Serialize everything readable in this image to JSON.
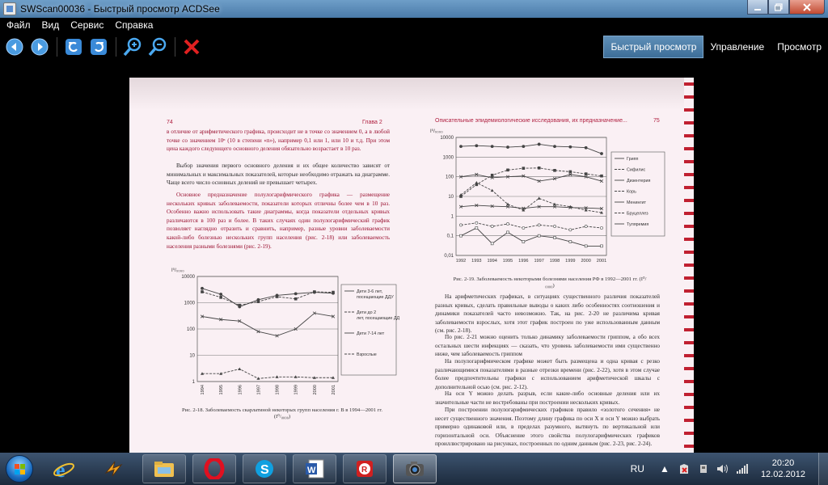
{
  "window": {
    "title": "SWScan00036 - Быстрый просмотр ACDSee"
  },
  "menu": [
    "Файл",
    "Вид",
    "Сервис",
    "Справка"
  ],
  "toolbar": {
    "buttons": [
      "back-icon",
      "forward-icon",
      "rotate-left-icon",
      "rotate-right-icon",
      "zoom-in-icon",
      "zoom-out-icon",
      "delete-icon"
    ]
  },
  "tabs": [
    {
      "label": "Быстрый просмотр",
      "active": true
    },
    {
      "label": "Управление",
      "active": false
    },
    {
      "label": "Просмотр",
      "active": false
    }
  ],
  "document": {
    "left_page_number": "74",
    "left_chapter": "Глава 2",
    "right_header": "Описательные эпидемиологические исследования, их предназначение...",
    "right_page_number": "75",
    "left_text_top_red": "в отличие от арифметического графика, происходит не в точке со значением 0, а в любой точке со значением 10ⁿ (10 в степени «n»), например 0,1 или 1, или 10 и т.д. При этом цена каждого следующего основного деления обязательно возрастает в 10 раз.",
    "left_text_p2": "Выбор значения первого основного деления и их общее количество зависят от минимальных и максимальных показателей, которые необходимо отражать на диаграмме. Чаще всего число основных делений не превышает четырех.",
    "left_text_p3": "Основное предназначение полулогарифмического графика — размещение нескольких кривых заболеваемости, показатели которых отличны более чем в 10 раз. Особенно важно использовать такие диаграммы, когда показатели отдельных кривых различаются в 100 раз и более. В таких случаях один полулогарифмический график позволяет наглядно отразить и сравнить, например, разные уровни заболеваемости какой-либо болезнью нескольких групп населения (рис. 2-18) или заболеваемость населения разными болезнями (рис. 2-19).",
    "fig18_caption": "Рис. 2-18. Заболеваемость скарлатиной некоторых групп населения г. В в 1994—2001 гг. (I⁰/₀₀₀₀)",
    "fig19_caption": "Рис. 2-19. Заболеваемость некоторыми болезнями населения РФ в 1992—2001 гг. (I⁰/₀₀₀₀)",
    "right_text_p1": "На арифметических графиках, в ситуациях существенного различия показателей разных кривых, сделать правильные выводы о каких либо особенностях соотношения и динамики показателей часто невозможно. Так, на рис. 2-20 не различима кривая заболеваемости взрослых, хотя этот график построен по уже использованным данным (см. рис. 2-18).",
    "right_text_p2": "По рис. 2-21 можно оценить только динамику заболеваемости гриппом, а обо всех остальных шести инфекциях — сказать, что уровень заболеваемости ими существенно ниже, чем заболеваемость гриппом",
    "right_text_p3": "На полулогарифмическом графике может быть размещена и одна кривая с резко различающимися показателями в разные отрезки времени (рис. 2-22), хотя в этом случае более предпочтительны графики с использованием арифметической шкалы с дополнительной осью (см. рис. 2-12).",
    "right_text_p4": "На оси Y можно делать разрыв, если какие-либо основные деления или их значительные части не востребованы при построении нескольких кривых.",
    "right_text_p5": "При построении полулогарифмических графиков правило «золотого сечения» не несет существенного значения. Поэтому длину графика по оси X и оси Y можно выбрать примерно одинаковой или, в пределах разумного, вытянуть по вертикальной или горизонтальной оси. Объяснение этого свойства полулогарифмических графиков проиллюстрировано на рисунках, построенных по одним данным (рис. 2-23, рис. 2-24)."
  },
  "chart_data": [
    {
      "type": "line",
      "ylabel": "I⁰/₀₀₀₀",
      "yscale": "log",
      "ylim": [
        1,
        10000
      ],
      "yticks": [
        "1",
        "10",
        "100",
        "1000",
        "10000"
      ],
      "x": [
        "1994",
        "1995",
        "1996",
        "1997",
        "1998",
        "1999",
        "2000",
        "2001"
      ],
      "series": [
        {
          "name": "Дети 3-6 лет, посещающие ДДУ",
          "values": [
            3500,
            2100,
            700,
            1300,
            1900,
            2200,
            2500,
            2300
          ]
        },
        {
          "name": "Дети до 2 лет, посещающие ДДУ",
          "values": [
            2600,
            1600,
            800,
            1100,
            1700,
            1400,
            2600,
            2500
          ]
        },
        {
          "name": "Дети 7-14 лет",
          "values": [
            300,
            230,
            200,
            80,
            55,
            100,
            400,
            300
          ]
        },
        {
          "name": "Взрослые",
          "values": [
            2,
            2,
            3,
            1.3,
            1.5,
            1.5,
            1.4,
            1.4
          ]
        }
      ]
    },
    {
      "type": "line",
      "ylabel": "I⁰/₀₀₀₀",
      "yscale": "log",
      "ylim": [
        0.01,
        10000
      ],
      "yticks": [
        "0,01",
        "0,1",
        "1",
        "10",
        "100",
        "1000",
        "10000"
      ],
      "x": [
        "1992",
        "1993",
        "1994",
        "1995",
        "1996",
        "1997",
        "1998",
        "1999",
        "2000",
        "2001"
      ],
      "series": [
        {
          "name": "Грипп",
          "values": [
            3500,
            3800,
            3500,
            3200,
            3500,
            4500,
            3500,
            3300,
            3000,
            1500
          ]
        },
        {
          "name": "Сифилис",
          "values": [
            10,
            40,
            120,
            220,
            270,
            280,
            210,
            180,
            140,
            110
          ]
        },
        {
          "name": "Дизентерия",
          "values": [
            100,
            130,
            90,
            100,
            110,
            60,
            80,
            130,
            100,
            60
          ]
        },
        {
          "name": "Корь",
          "values": [
            12,
            50,
            20,
            4,
            2,
            8,
            4,
            3,
            2,
            1.5
          ]
        },
        {
          "name": "Менингит",
          "values": [
            3,
            3.5,
            3.2,
            3,
            2.5,
            3,
            3,
            2.7,
            2.6,
            2.4
          ]
        },
        {
          "name": "Бруцеллез",
          "values": [
            0.35,
            0.45,
            0.3,
            0.4,
            0.25,
            0.35,
            0.3,
            0.2,
            0.3,
            0.25
          ]
        },
        {
          "name": "Туляремия",
          "values": [
            0.1,
            0.25,
            0.04,
            0.15,
            0.05,
            0.1,
            0.08,
            0.05,
            0.03,
            0.03
          ]
        }
      ]
    }
  ],
  "taskbar": {
    "apps": [
      "windows-explorer",
      "internet-explorer",
      "winamp",
      "file-manager",
      "opera",
      "skype",
      "word",
      "foxit-reader",
      "acdsee"
    ],
    "language": "RU",
    "time": "20:20",
    "date": "12.02.2012"
  }
}
